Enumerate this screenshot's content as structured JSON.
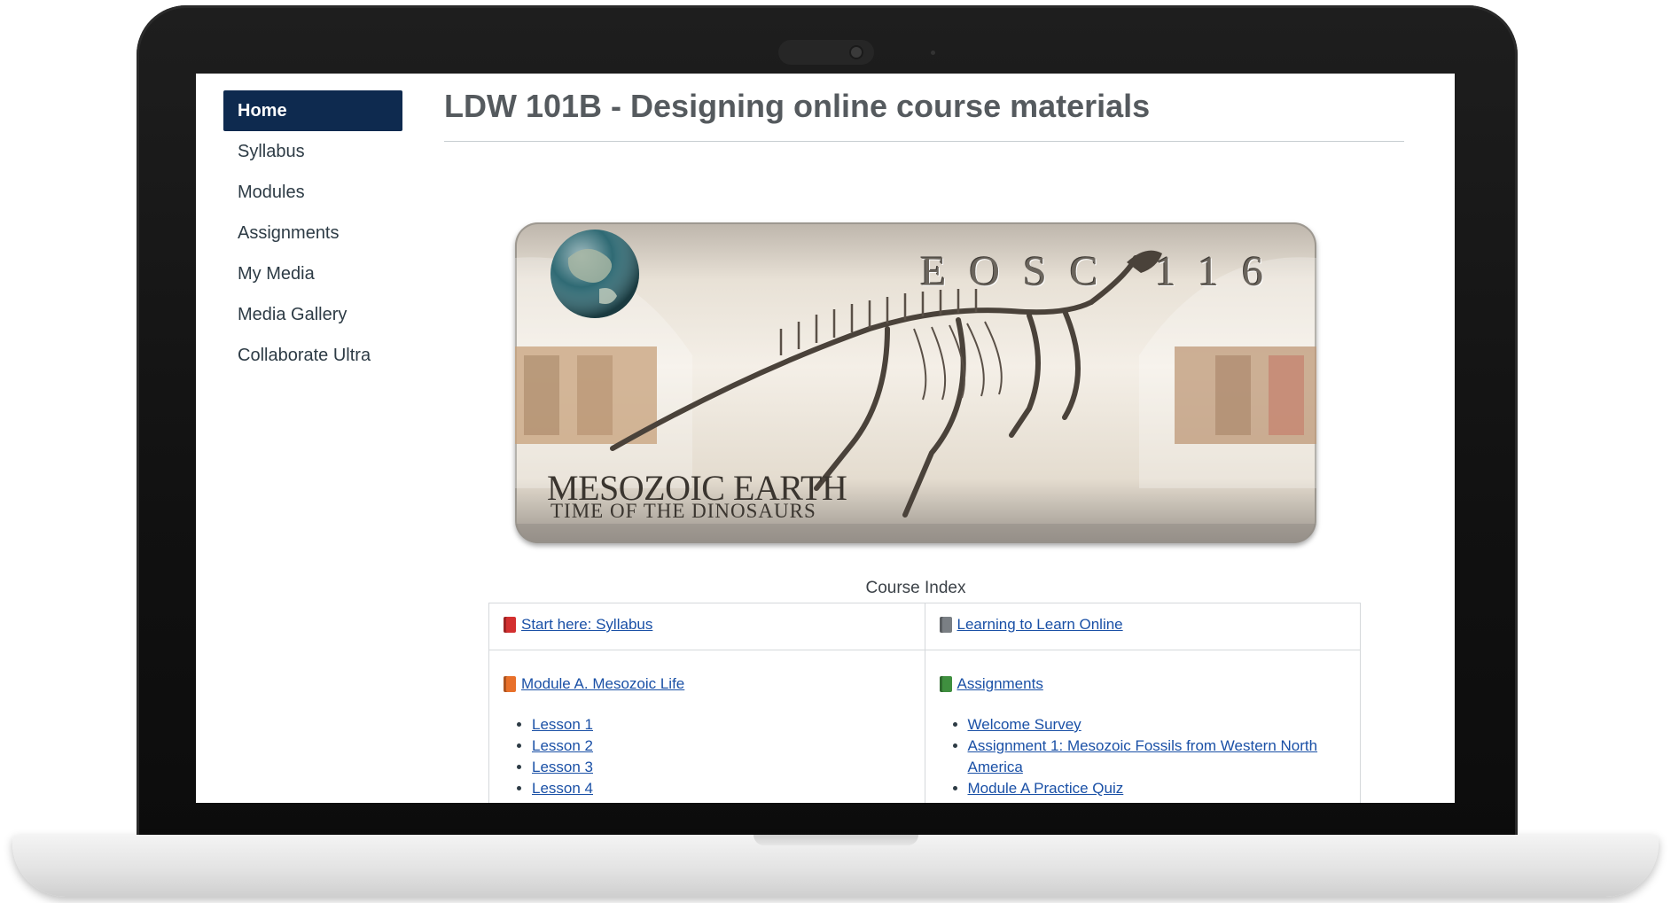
{
  "course": {
    "title": "LDW 101B - Designing online course materials"
  },
  "sidebar": {
    "items": [
      {
        "label": "Home",
        "active": true
      },
      {
        "label": "Syllabus"
      },
      {
        "label": "Modules"
      },
      {
        "label": "Assignments"
      },
      {
        "label": "My Media"
      },
      {
        "label": "Media Gallery"
      },
      {
        "label": "Collaborate Ultra"
      }
    ]
  },
  "banner": {
    "course_code": "EOSC 116",
    "title": "MESOZOIC EARTH",
    "subtitle": "TIME OF THE DINOSAURS"
  },
  "course_index": {
    "caption": "Course Index",
    "cells": {
      "syllabus": {
        "label": "Start here: Syllabus",
        "icon": "book-icon",
        "color": "#d32f2f"
      },
      "learning": {
        "label": "Learning to Learn Online",
        "icon": "book-icon",
        "color": "#7a7f84"
      },
      "module_a": {
        "label": "Module A. Mesozoic Life",
        "icon": "book-icon",
        "color": "#e8702a",
        "items": [
          "Lesson 1",
          "Lesson 2",
          "Lesson 3",
          "Lesson 4"
        ]
      },
      "assignments": {
        "label": "Assignments",
        "icon": "book-icon",
        "color": "#3f8f3f",
        "items": [
          "Welcome Survey",
          "Assignment 1: Mesozoic Fossils from Western North America",
          "Module A Practice Quiz"
        ]
      }
    }
  }
}
